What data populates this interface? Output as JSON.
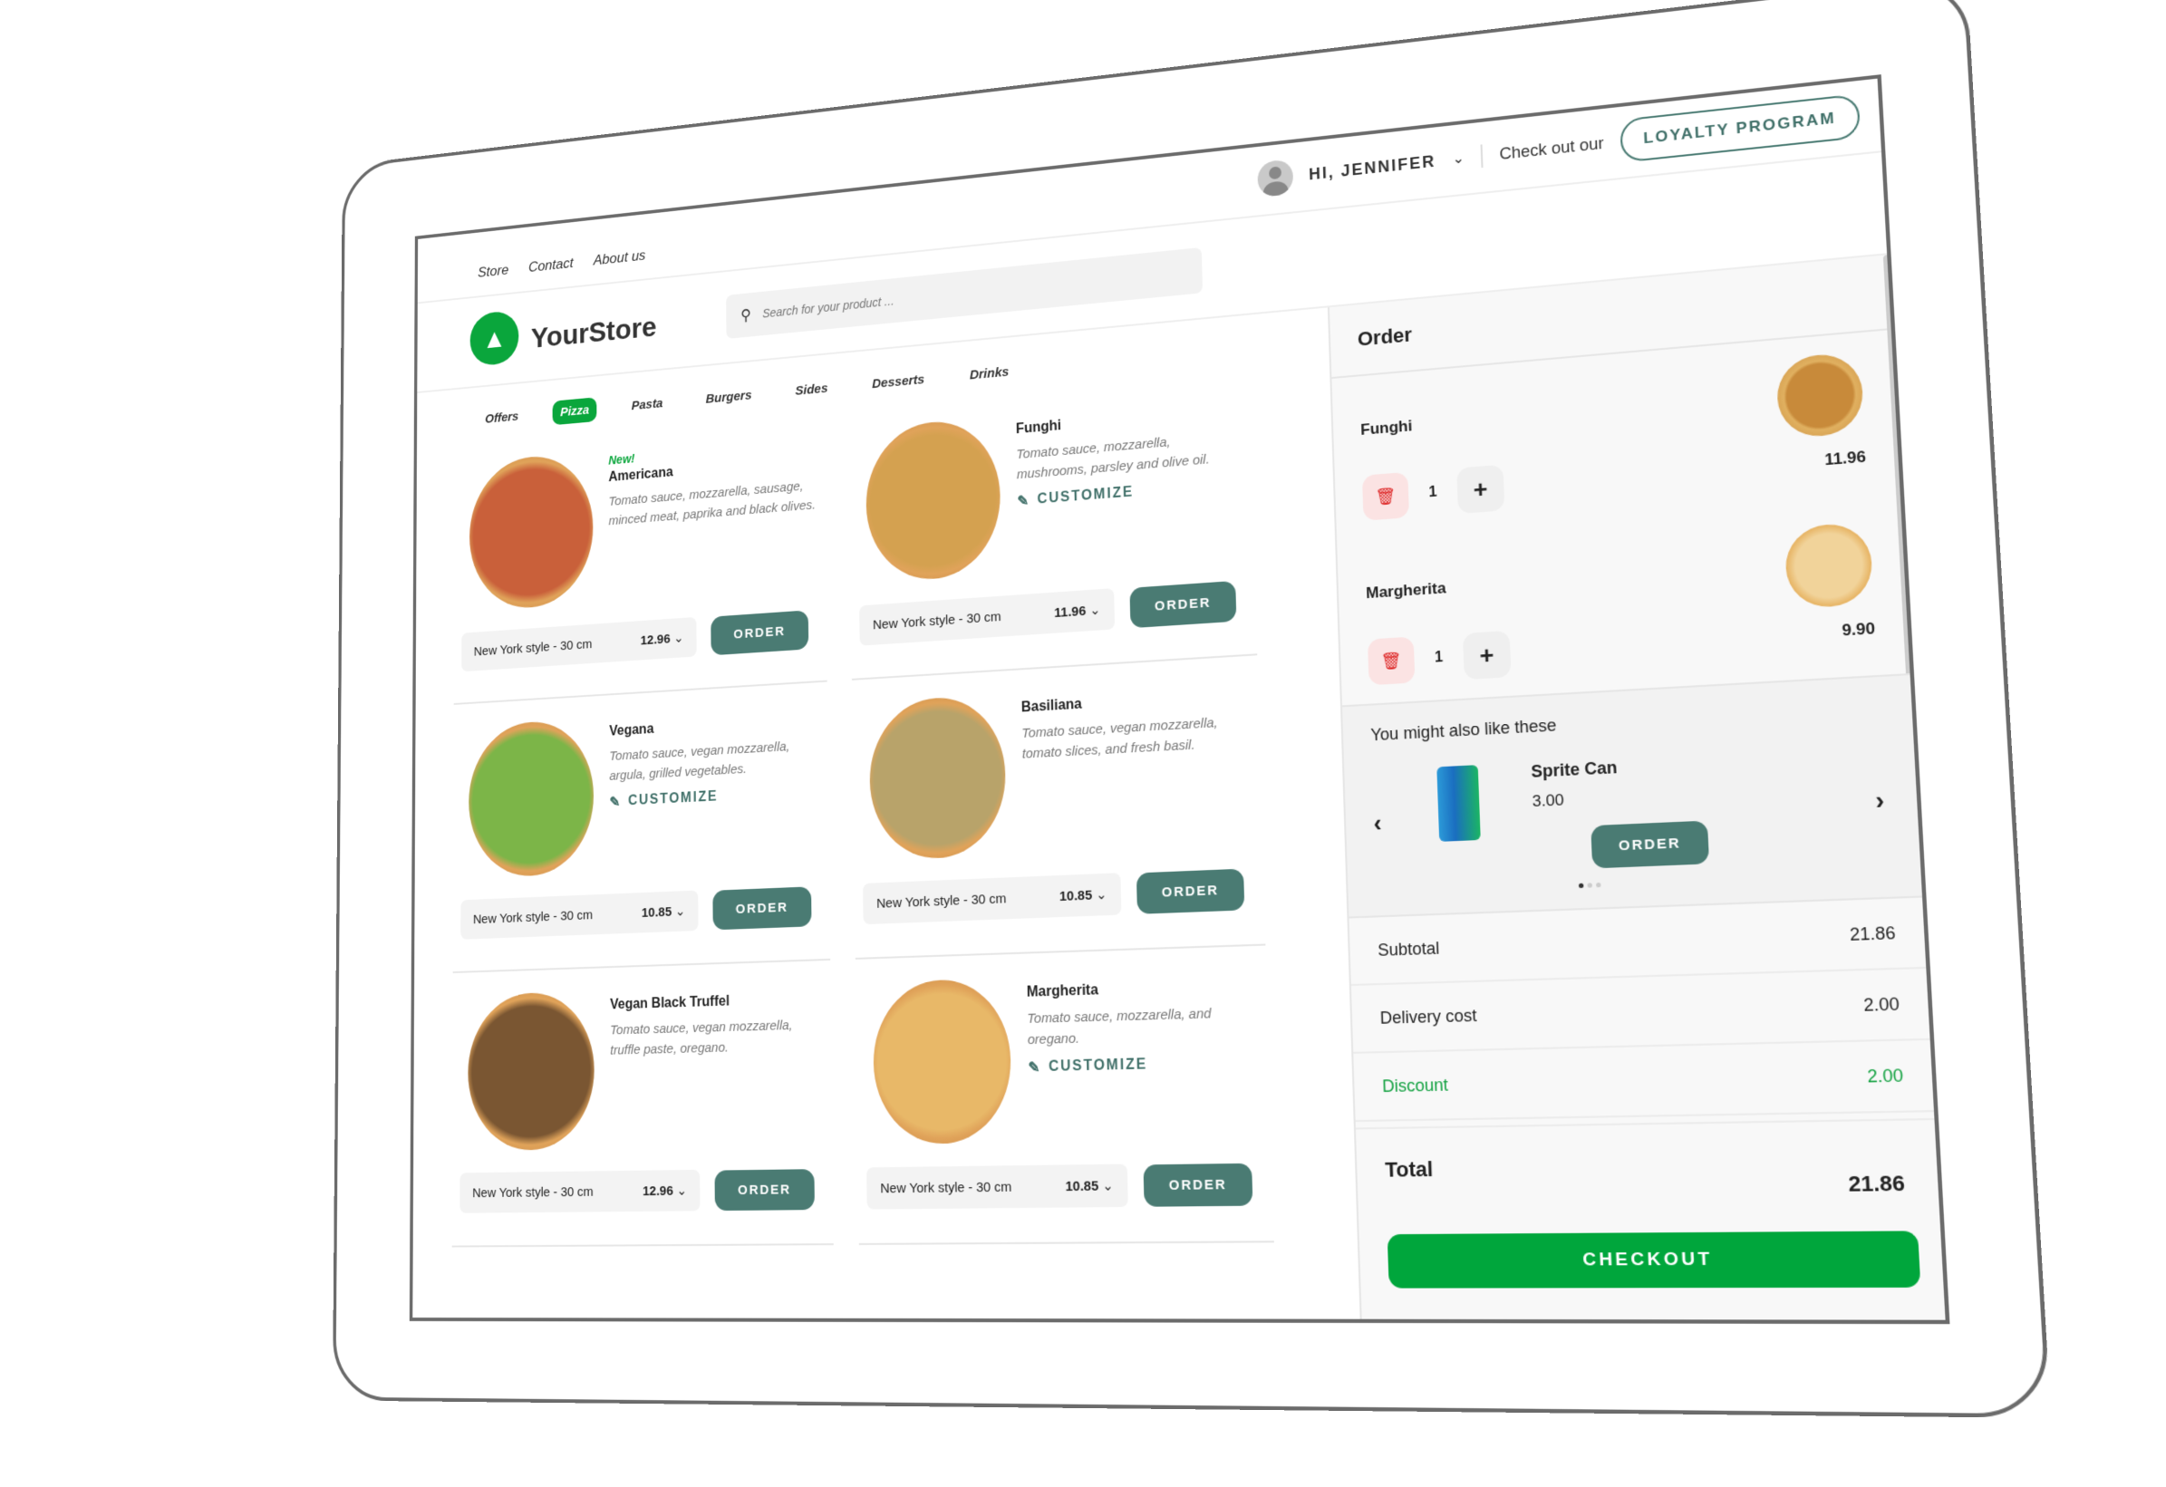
{
  "nav": {
    "links": [
      "Store",
      "Contact",
      "About us"
    ]
  },
  "user": {
    "greeting": "HI, JENNIFER",
    "promo_text": "Check out our",
    "loyalty_label": "LOYALTY PROGRAM"
  },
  "brand": {
    "name": "YourStore"
  },
  "search": {
    "placeholder": "Search for your product ..."
  },
  "categories": [
    {
      "label": "Offers",
      "active": false
    },
    {
      "label": "Pizza",
      "active": true
    },
    {
      "label": "Pasta",
      "active": false
    },
    {
      "label": "Burgers",
      "active": false
    },
    {
      "label": "Sides",
      "active": false
    },
    {
      "label": "Desserts",
      "active": false
    },
    {
      "label": "Drinks",
      "active": false
    }
  ],
  "products": [
    {
      "badge": "New!",
      "name": "Americana",
      "desc": "Tomato sauce, mozzarella, sausage, minced meat, paprika and black olives.",
      "customize": "",
      "size": "New York style - 30 cm",
      "price": "12.96",
      "order": "ORDER",
      "color": "#c9603a"
    },
    {
      "badge": "",
      "name": "Funghi",
      "desc": "Tomato sauce, mozzarella, mushrooms, parsley and olive oil.",
      "customize": "CUSTOMIZE",
      "size": "New York style - 30 cm",
      "price": "11.96",
      "order": "ORDER",
      "color": "#d4a150"
    },
    {
      "badge": "",
      "name": "Vegana",
      "desc": "Tomato sauce, vegan mozzarella, argula, grilled vegetables.",
      "customize": "CUSTOMIZE",
      "size": "New York style - 30 cm",
      "price": "10.85",
      "order": "ORDER",
      "color": "#7cb548"
    },
    {
      "badge": "",
      "name": "Basiliana",
      "desc": "Tomato sauce, vegan mozzarella, tomato slices, and fresh basil.",
      "customize": "",
      "size": "New York style - 30 cm",
      "price": "10.85",
      "order": "ORDER",
      "color": "#b8a36a"
    },
    {
      "badge": "",
      "name": "Vegan Black Truffel",
      "desc": "Tomato sauce, vegan mozzarella, truffle paste, oregano.",
      "customize": "",
      "size": "New York style - 30 cm",
      "price": "12.96",
      "order": "ORDER",
      "color": "#7a5632"
    },
    {
      "badge": "",
      "name": "Margherita",
      "desc": "Tomato sauce, mozzarella, and oregano.",
      "customize": "CUSTOMIZE",
      "size": "New York style - 30 cm",
      "price": "10.85",
      "order": "ORDER",
      "color": "#e8b868"
    }
  ],
  "order": {
    "title": "Order",
    "items": [
      {
        "name": "Funghi",
        "qty": "1",
        "price": "11.96",
        "color": "#d4a150"
      },
      {
        "name": "Margherita",
        "qty": "1",
        "price": "9.90",
        "color": "#e8b868"
      }
    ],
    "suggest": {
      "title": "You might also like these",
      "name": "Sprite Can",
      "price": "3.00",
      "order": "ORDER",
      "page": 1,
      "pages": 3
    },
    "subtotal_label": "Subtotal",
    "subtotal": "21.86",
    "delivery_label": "Delivery cost",
    "delivery": "2.00",
    "discount_label": "Discount",
    "discount": "2.00",
    "total_label": "Total",
    "total": "21.86",
    "checkout": "CHECKOUT"
  }
}
